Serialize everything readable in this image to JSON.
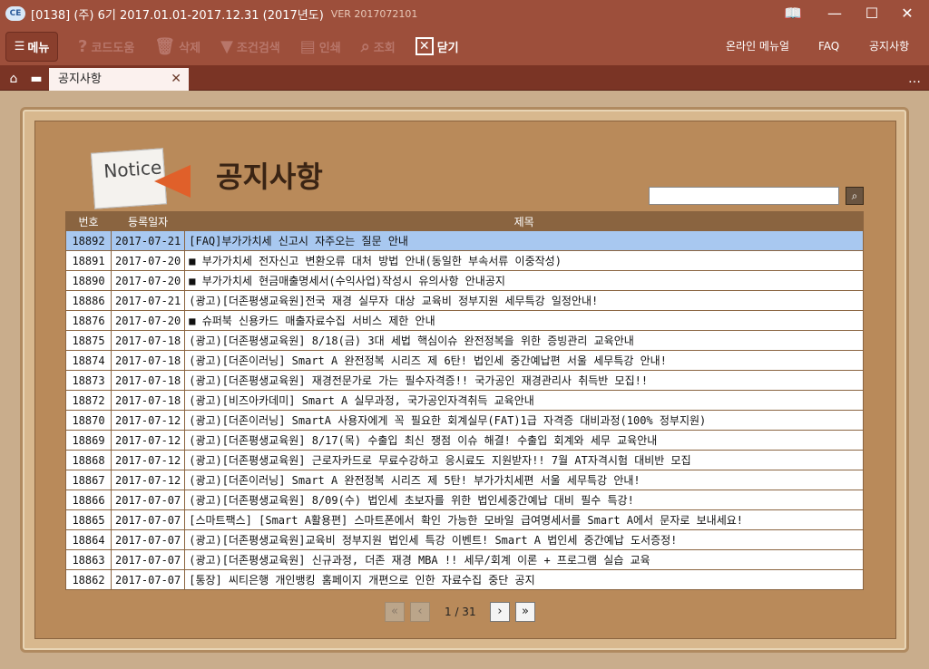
{
  "window": {
    "title": "[0138] (주)      6기  2017.01.01-2017.12.31  (2017년도)",
    "version": "VER 2017072101",
    "logo": "CE"
  },
  "toolbar": {
    "menu": "메뉴",
    "code_help": "코드도움",
    "delete": "삭제",
    "filter": "조건검색",
    "print": "인쇄",
    "search": "조회",
    "close": "닫기",
    "online_manual": "온라인 메뉴얼",
    "faq": "FAQ",
    "notice": "공지사항"
  },
  "tabs": [
    {
      "label": "공지사항"
    }
  ],
  "page": {
    "title": "공지사항",
    "notice_image_text": "Notice",
    "search_value": ""
  },
  "table": {
    "headers": [
      "번호",
      "등록일자",
      "제목"
    ],
    "rows": [
      [
        "18892",
        "2017-07-21",
        "[FAQ]부가가치세 신고시 자주오는 질문 안내"
      ],
      [
        "18891",
        "2017-07-20",
        "■ 부가가치세 전자신고 변환오류 대처 방법 안내(동일한 부속서류 이중작성)"
      ],
      [
        "18890",
        "2017-07-20",
        "■ 부가가치세 현금매출명세서(수익사업)작성시 유의사항 안내공지"
      ],
      [
        "18886",
        "2017-07-21",
        "(광고)[더존평생교육원]전국 재경 실무자 대상 교육비 정부지원 세무특강 일정안내!"
      ],
      [
        "18876",
        "2017-07-20",
        "■ 슈퍼북 신용카드 매출자료수집 서비스 제한 안내"
      ],
      [
        "18875",
        "2017-07-18",
        "(광고)[더존평생교육원] 8/18(금) 3대 세법 핵심이슈 완전정복을 위한 증빙관리 교육안내"
      ],
      [
        "18874",
        "2017-07-18",
        "(광고)[더존이러닝] Smart A 완전정복 시리즈 제 6탄! 법인세 중간예납편 서울 세무특강 안내!"
      ],
      [
        "18873",
        "2017-07-18",
        "(광고)[더존평생교육원] 재경전문가로 가는 필수자격증!! 국가공인 재경관리사 취득반 모집!!"
      ],
      [
        "18872",
        "2017-07-18",
        "(광고)[비즈아카데미] Smart A 실무과정, 국가공인자격취득 교육안내"
      ],
      [
        "18870",
        "2017-07-12",
        "(광고)[더존이러닝] SmartA 사용자에게 꼭 필요한 회계실무(FAT)1급 자격증 대비과정(100% 정부지원)"
      ],
      [
        "18869",
        "2017-07-12",
        "(광고)[더존평생교육원] 8/17(목) 수출입 최신 쟁점 이슈 해결! 수출입 회계와 세무 교육안내"
      ],
      [
        "18868",
        "2017-07-12",
        "(광고)[더존평생교육원] 근로자카드로 무료수강하고 응시료도 지원받자!! 7월 AT자격시험 대비반 모집"
      ],
      [
        "18867",
        "2017-07-12",
        "(광고)[더존이러닝] Smart A 완전정복 시리즈 제 5탄! 부가가치세편 서울 세무특강 안내!"
      ],
      [
        "18866",
        "2017-07-07",
        "(광고)[더존평생교육원] 8/09(수) 법인세 초보자를 위한 법인세중간예납 대비 필수 특강!"
      ],
      [
        "18865",
        "2017-07-07",
        "[스마트팩스] [Smart A활용편] 스마트폰에서 확인 가능한 모바일 급여명세서를 Smart A에서 문자로 보내세요!"
      ],
      [
        "18864",
        "2017-07-07",
        "(광고)[더존평생교육원]교육비 정부지원 법인세 특강 이벤트! Smart A 법인세 중간예납 도서증정!"
      ],
      [
        "18863",
        "2017-07-07",
        "(광고)[더존평생교육원] 신규과정, 더존 재경 MBA !! 세무/회계 이론 + 프로그램 실습 교육"
      ],
      [
        "18862",
        "2017-07-07",
        "[통장] 씨티은행  개인뱅킹 홈페이지 개편으로 인한 자료수집  중단 공지"
      ]
    ]
  },
  "pagination": {
    "text": "1 / 31",
    "current": 1,
    "total": 31
  }
}
